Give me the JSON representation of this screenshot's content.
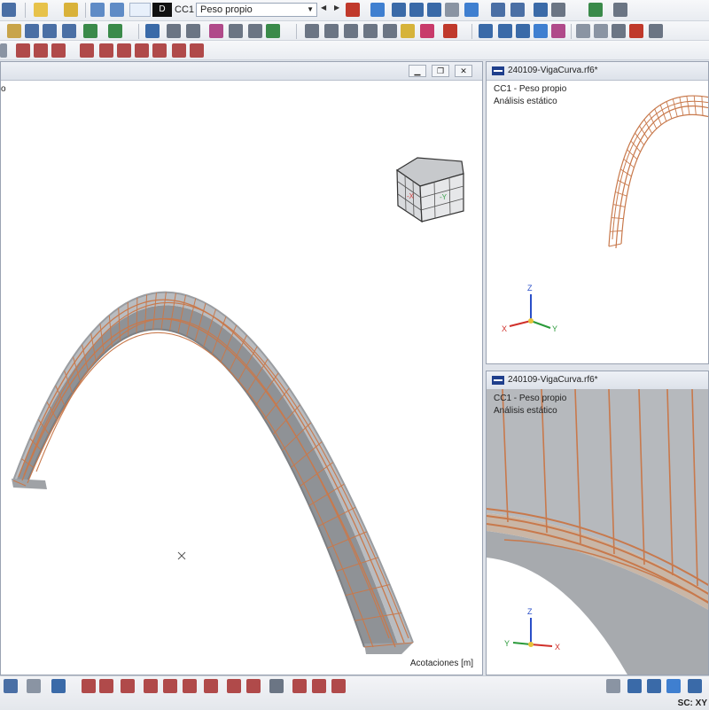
{
  "toolbar": {
    "load_case_type": "D",
    "load_case_code": "CC1",
    "load_case_name": "Peso propio"
  },
  "main_view": {
    "info_line": "o",
    "dimension_label": "Acotaciones [m]",
    "cube_labels": {
      "x": "-X",
      "y": "-Y"
    }
  },
  "top_right_view": {
    "title": "240109-VigaCurva.rf6*",
    "load_case": "CC1 - Peso propio",
    "analysis": "Análisis estático",
    "axes": {
      "x": "X",
      "y": "Y",
      "z": "Z"
    }
  },
  "bottom_right_view": {
    "title": "240109-VigaCurva.rf6*",
    "load_case": "CC1 - Peso propio",
    "analysis": "Análisis estático",
    "axes": {
      "x": "X",
      "y": "Y",
      "z": "Z"
    }
  },
  "status_bar": {
    "coordinate_system": "SC: XY"
  },
  "colors": {
    "rebar": "#c8794c",
    "concrete": "#a9acb0",
    "highlight": "#3f7fd0"
  }
}
